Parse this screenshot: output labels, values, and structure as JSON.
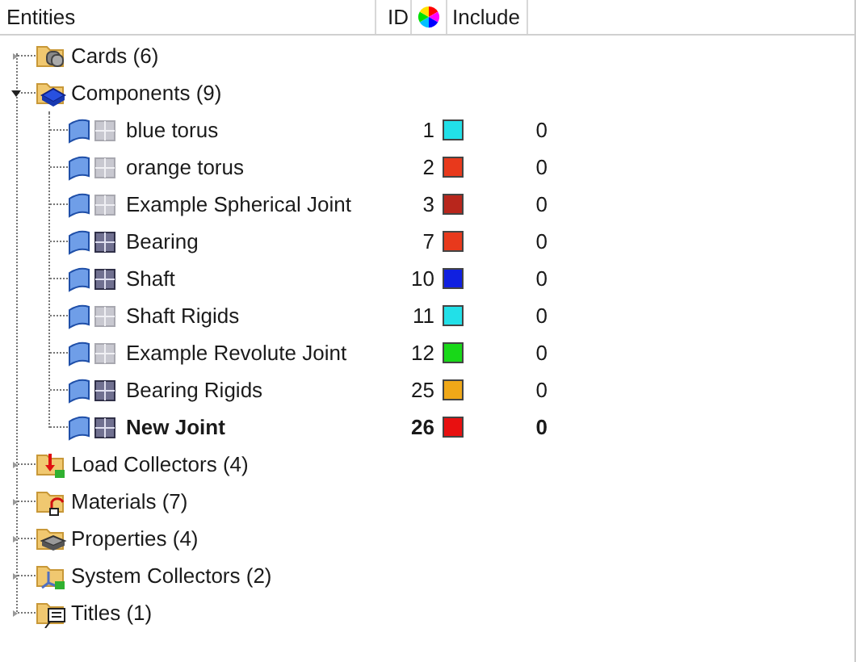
{
  "columns": [
    "Entities",
    "ID",
    "Include"
  ],
  "groups": [
    {
      "kind": "cards",
      "label": "Cards (6)",
      "expanded": false
    },
    {
      "kind": "components",
      "label": "Components (9)",
      "expanded": true,
      "children": [
        {
          "name": "blue torus",
          "id": "1",
          "color": "#22e0e8",
          "include": "0",
          "mesh_shown": false,
          "current": false
        },
        {
          "name": "orange torus",
          "id": "2",
          "color": "#e8391c",
          "include": "0",
          "mesh_shown": false,
          "current": false
        },
        {
          "name": "Example Spherical Joint",
          "id": "3",
          "color": "#b8261c",
          "include": "0",
          "mesh_shown": false,
          "current": false
        },
        {
          "name": "Bearing",
          "id": "7",
          "color": "#e8391c",
          "include": "0",
          "mesh_shown": true,
          "current": false
        },
        {
          "name": "Shaft",
          "id": "10",
          "color": "#1020e0",
          "include": "0",
          "mesh_shown": true,
          "current": false
        },
        {
          "name": "Shaft Rigids",
          "id": "11",
          "color": "#22e0e8",
          "include": "0",
          "mesh_shown": false,
          "current": false
        },
        {
          "name": "Example Revolute Joint",
          "id": "12",
          "color": "#18d818",
          "include": "0",
          "mesh_shown": false,
          "current": false
        },
        {
          "name": "Bearing Rigids",
          "id": "25",
          "color": "#f0a818",
          "include": "0",
          "mesh_shown": true,
          "current": false
        },
        {
          "name": "New Joint",
          "id": "26",
          "color": "#e81010",
          "include": "0",
          "mesh_shown": true,
          "current": true
        }
      ]
    },
    {
      "kind": "loads",
      "label": "Load Collectors (4)",
      "expanded": false
    },
    {
      "kind": "materials",
      "label": "Materials (7)",
      "expanded": false
    },
    {
      "kind": "properties",
      "label": "Properties (4)",
      "expanded": false
    },
    {
      "kind": "systems",
      "label": "System Collectors (2)",
      "expanded": false
    },
    {
      "kind": "titles",
      "label": "Titles (1)",
      "expanded": false
    }
  ]
}
